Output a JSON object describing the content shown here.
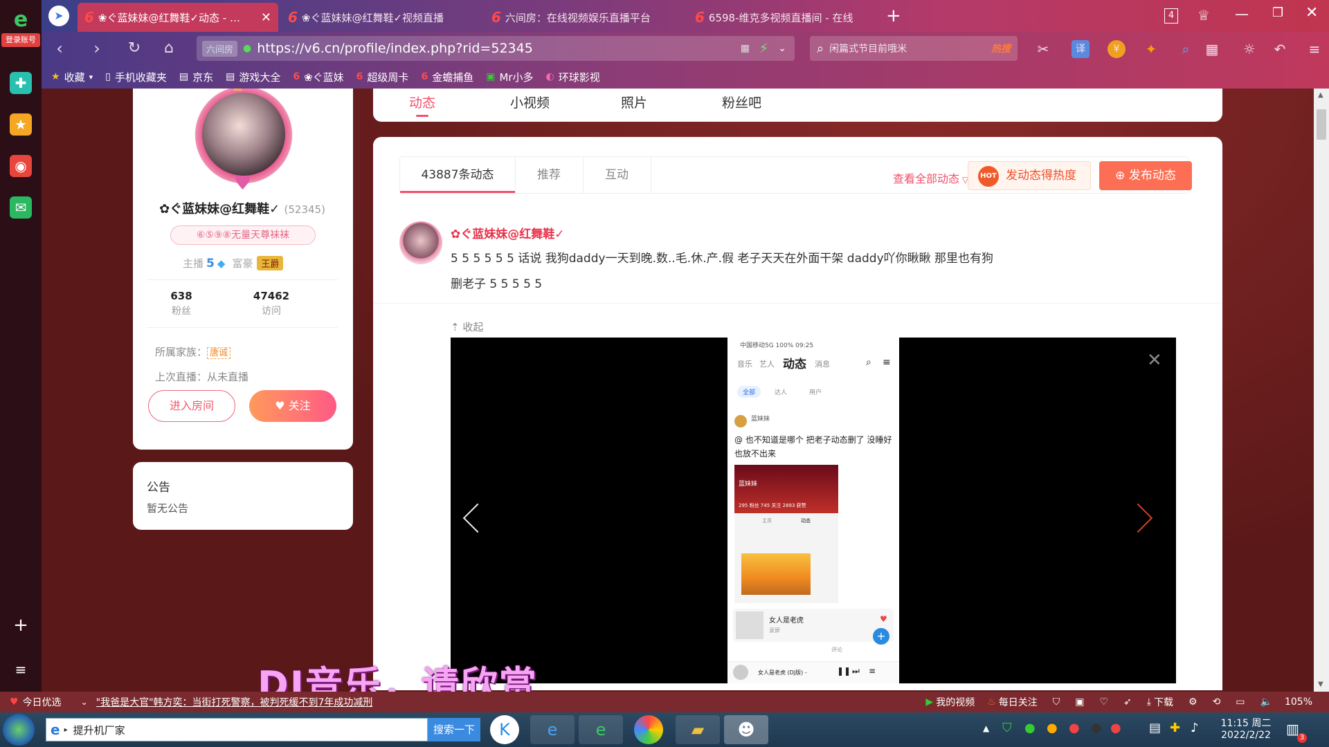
{
  "sidebar": {
    "login_label": "登录账号"
  },
  "tabs": [
    {
      "title": "❀ぐ蓝妹妹@红舞鞋✓动态 - 在线",
      "active": true
    },
    {
      "title": "❀ぐ蓝妹妹@红舞鞋✓视频直播",
      "active": false
    },
    {
      "title": "六间房：在线视频娱乐直播平台",
      "active": false
    },
    {
      "title": "6598-维克多视频直播间 - 在线",
      "active": false
    }
  ],
  "tab_count": "4",
  "address": {
    "site_tag": "六间房",
    "url": "https://v6.cn/profile/index.php?rid=52345"
  },
  "search": {
    "placeholder": "闲篇式节目前哦米",
    "hot": "热搜"
  },
  "bookmarks": [
    "收藏",
    "手机收藏夹",
    "京东",
    "游戏大全",
    "❀ぐ蓝妹",
    "超级周卡",
    "金蟾捕鱼",
    "Mr小多",
    "环球影视"
  ],
  "profile": {
    "name": "✿ぐ蓝妹妹@红舞鞋✓",
    "rid": "(52345)",
    "badge": "⑥⑤⑨⑧无量天尊袜袜",
    "anchor_label": "主播",
    "anchor_level": "5",
    "rich_label": "富豪",
    "rich_title": "王爵",
    "fans_count": "638",
    "fans_label": "粉丝",
    "visits_count": "47462",
    "visits_label": "访问",
    "family_label": "所属家族：",
    "family_value": "唐诚",
    "last_live": "上次直播：从未直播",
    "enter_room": "进入房间",
    "follow": "关注"
  },
  "notice": {
    "title": "公告",
    "content": "暂无公告"
  },
  "nav": [
    "动态",
    "小视频",
    "照片",
    "粉丝吧"
  ],
  "feed": {
    "tabs": [
      "43887条动态",
      "推荐",
      "互动"
    ],
    "view_all": "查看全部动态",
    "hot_button": "发动态得热度",
    "hot_icon": "HOT",
    "post_button": "发布动态",
    "post": {
      "author": "✿ぐ蓝妹妹@红舞鞋✓",
      "text_line1": "5 5 5 5 5 5 话说 我狗daddy一天到晚.数..毛.休.产.假 老子天天在外面干架 daddy吖你瞅瞅 那里也有狗",
      "text_line2": "删老子 5 5 5 5 5",
      "collapse": "收起"
    }
  },
  "phone": {
    "status": "中国移动5G 100% 09:25",
    "tabs": [
      "音乐",
      "艺人",
      "动态",
      "消息"
    ],
    "filters": [
      "全部",
      "达人",
      "用户"
    ],
    "post_name": "蓝妹妹",
    "post_text": "@ 也不知道是哪个 把老子动态删了 没睡好 也放不出来",
    "inner_name": "蓝妹妹",
    "inner_stats": "295 粉丝  745 关注  2893 获赞",
    "inner_tabs": [
      "主页",
      "动态"
    ],
    "music_title": "女人是老虎",
    "music_sub": "录屏",
    "player_title": "女人是老虎 (DJ版) -",
    "comment": "评论"
  },
  "subtitle": "DJ音乐，请欣赏",
  "statusbar": {
    "today": "今日优选",
    "headline": "\"我爸是大官\"韩方奕：当街打死警察，被判死缓不到7年成功减刑",
    "my_video": "我的视频",
    "daily": "每日关注",
    "download": "下载",
    "zoom": "105%"
  },
  "taskbar": {
    "ie_label": "提升机厂家",
    "search_btn": "搜索一下",
    "time": "11:15 周二",
    "date": "2022/2/22",
    "notif": "3"
  }
}
